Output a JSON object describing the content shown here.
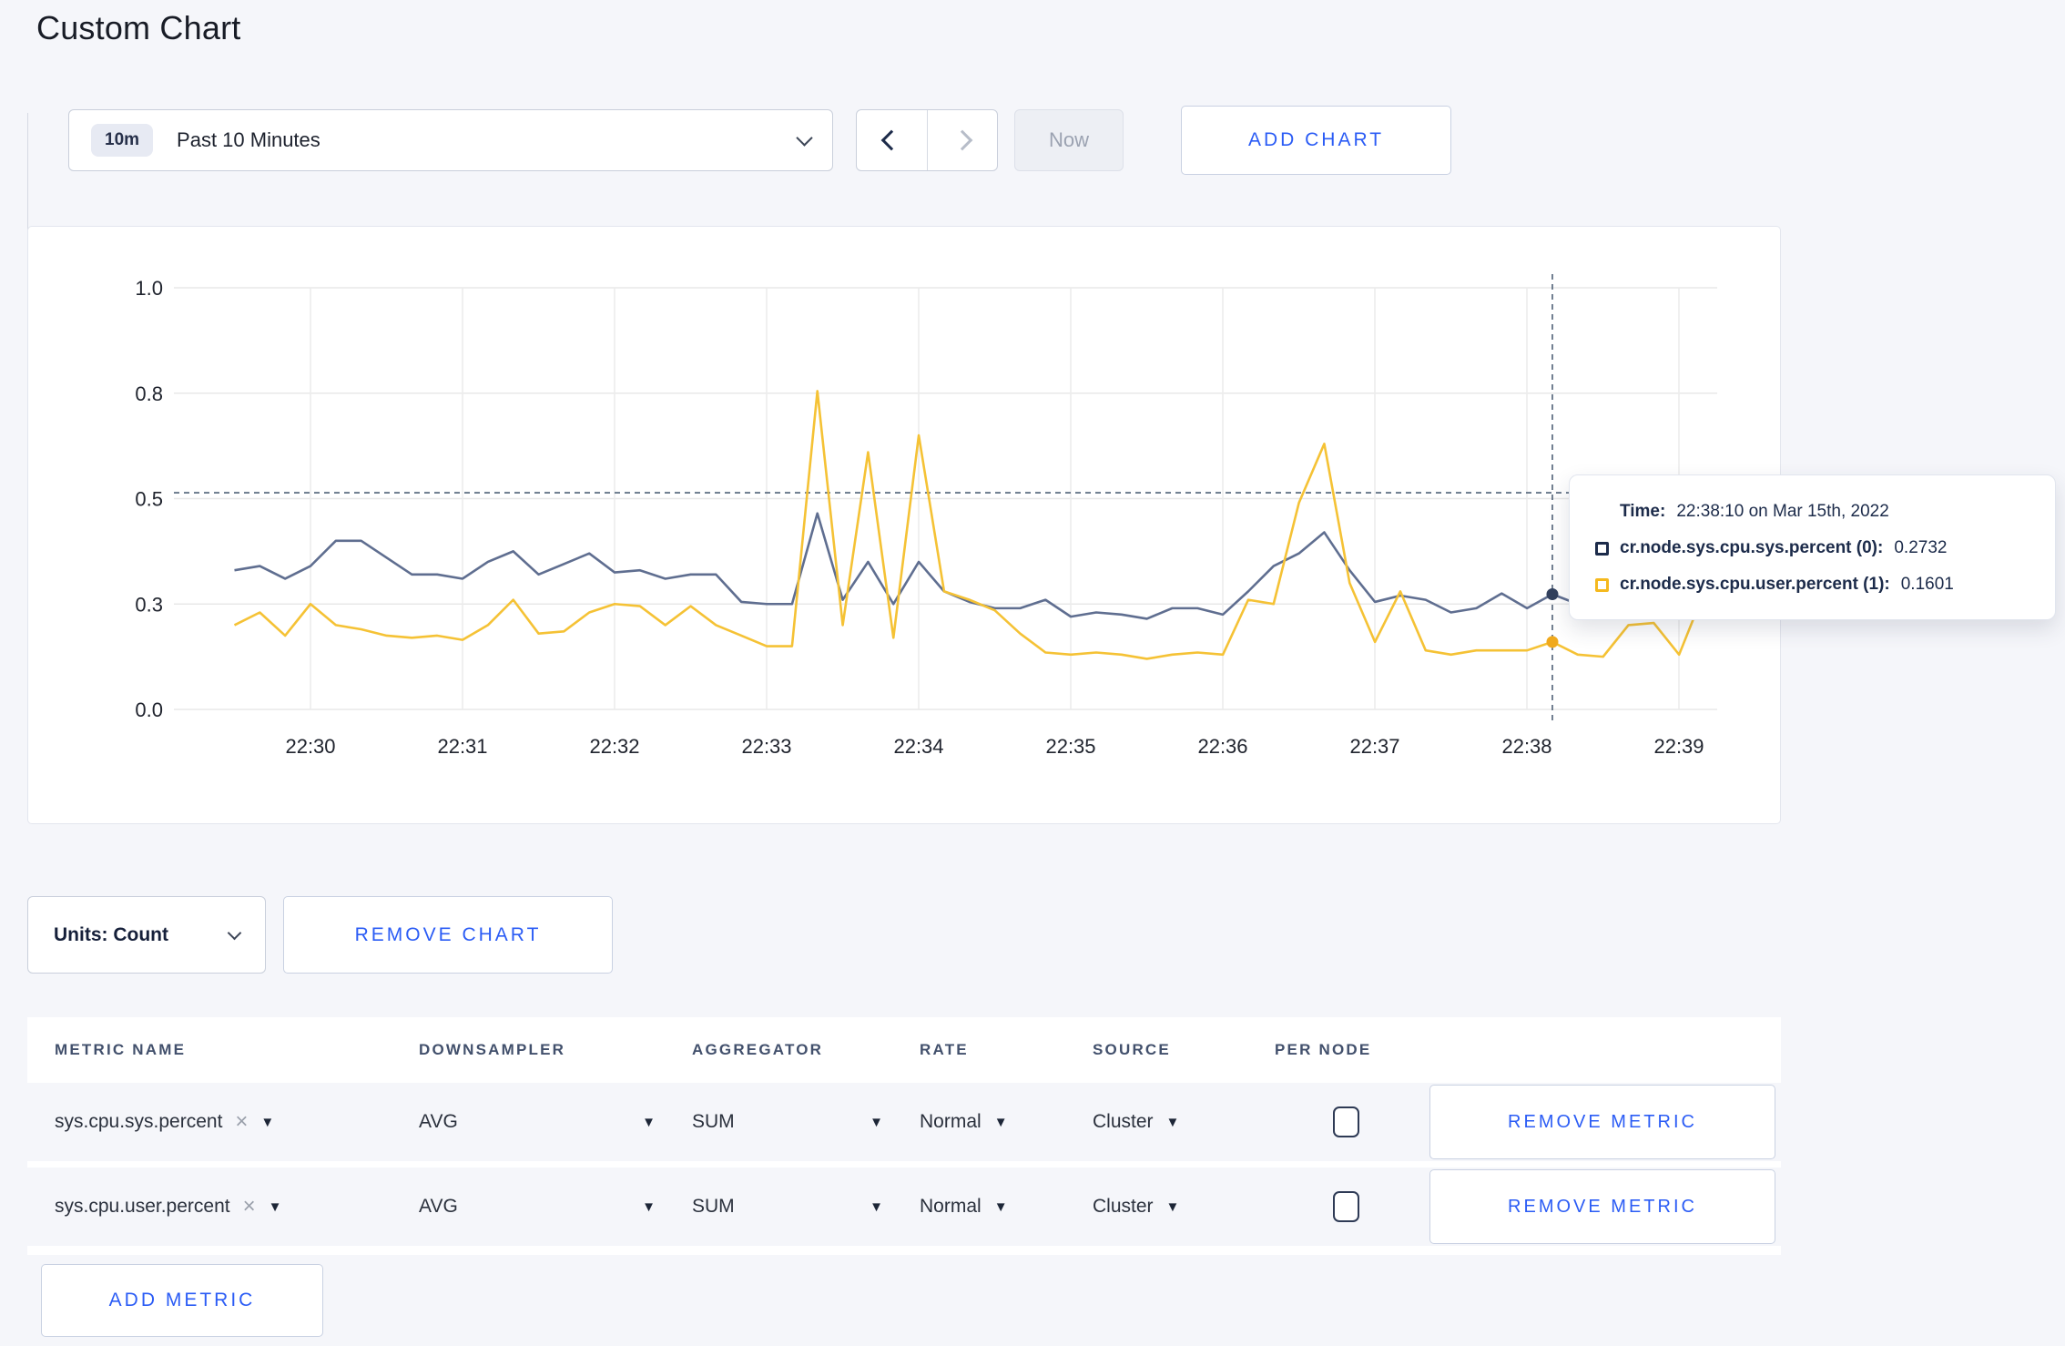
{
  "page": {
    "title": "Custom Chart"
  },
  "toolbar": {
    "range_badge": "10m",
    "range_label": "Past 10 Minutes",
    "prev_icon": "chevron-left-icon",
    "next_icon": "chevron-right-icon",
    "now_label": "Now",
    "add_chart_label": "ADD CHART"
  },
  "tooltip": {
    "time_label": "Time:",
    "time_value": "22:38:10 on Mar 15th, 2022",
    "series": [
      {
        "name": "cr.node.sys.cpu.sys.percent (0):",
        "value": "0.2732",
        "color": "#1c2b4a"
      },
      {
        "name": "cr.node.sys.cpu.user.percent (1):",
        "value": "0.1601",
        "color": "#f5b91e"
      }
    ]
  },
  "chart_controls": {
    "units_label": "Units: Count",
    "remove_chart_label": "REMOVE CHART",
    "add_metric_label": "ADD METRIC"
  },
  "metrics_table": {
    "headers": [
      "METRIC NAME",
      "DOWNSAMPLER",
      "AGGREGATOR",
      "RATE",
      "SOURCE",
      "PER NODE"
    ],
    "rows": [
      {
        "name": "sys.cpu.sys.percent",
        "downsampler": "AVG",
        "aggregator": "SUM",
        "rate": "Normal",
        "source": "Cluster",
        "per_node_checked": false,
        "remove_label": "REMOVE METRIC"
      },
      {
        "name": "sys.cpu.user.percent",
        "downsampler": "AVG",
        "aggregator": "SUM",
        "rate": "Normal",
        "source": "Cluster",
        "per_node_checked": false,
        "remove_label": "REMOVE METRIC"
      }
    ]
  },
  "chart_data": {
    "type": "line",
    "ylim": [
      0,
      1
    ],
    "y_ticks": {
      "values": [
        0,
        0.25,
        0.5,
        0.75,
        1.0
      ],
      "labels": [
        "0.0",
        "0.3",
        "0.5",
        "0.8",
        "1.0"
      ]
    },
    "x_ticks": [
      "22:30",
      "22:31",
      "22:32",
      "22:33",
      "22:34",
      "22:35",
      "22:36",
      "22:37",
      "22:38",
      "22:39"
    ],
    "grid": true,
    "legend_position": "tooltip",
    "sample_interval_seconds": 10,
    "series": [
      {
        "name": "cr.node.sys.cpu.sys.percent",
        "color": "#5f6e90",
        "dot_color": "#32415e",
        "values": [
          0.33,
          0.34,
          0.31,
          0.34,
          0.4,
          0.4,
          0.36,
          0.32,
          0.32,
          0.31,
          0.35,
          0.375,
          0.32,
          0.345,
          0.37,
          0.325,
          0.33,
          0.31,
          0.32,
          0.32,
          0.255,
          0.25,
          0.25,
          0.465,
          0.26,
          0.35,
          0.25,
          0.35,
          0.28,
          0.255,
          0.24,
          0.24,
          0.26,
          0.22,
          0.23,
          0.225,
          0.215,
          0.24,
          0.24,
          0.225,
          0.28,
          0.34,
          0.37,
          0.42,
          0.33,
          0.255,
          0.27,
          0.26,
          0.23,
          0.24,
          0.275,
          0.24,
          0.2732,
          0.25,
          0.26,
          0.28,
          0.29,
          0.3,
          0.3
        ]
      },
      {
        "name": "cr.node.sys.cpu.user.percent",
        "color": "#f5c235",
        "dot_color": "#f0a91c",
        "values": [
          0.2,
          0.23,
          0.175,
          0.25,
          0.2,
          0.19,
          0.175,
          0.17,
          0.175,
          0.165,
          0.2,
          0.26,
          0.18,
          0.185,
          0.23,
          0.25,
          0.245,
          0.2,
          0.245,
          0.2,
          0.175,
          0.15,
          0.15,
          0.755,
          0.2,
          0.61,
          0.17,
          0.65,
          0.28,
          0.26,
          0.235,
          0.18,
          0.135,
          0.13,
          0.135,
          0.13,
          0.12,
          0.13,
          0.135,
          0.13,
          0.26,
          0.25,
          0.49,
          0.63,
          0.3,
          0.16,
          0.28,
          0.14,
          0.13,
          0.14,
          0.14,
          0.14,
          0.1601,
          0.13,
          0.125,
          0.2,
          0.205,
          0.13,
          0.28
        ]
      }
    ],
    "crosshair": {
      "point_index": 52,
      "y_value": 0.514,
      "time": "22:38:10"
    }
  }
}
